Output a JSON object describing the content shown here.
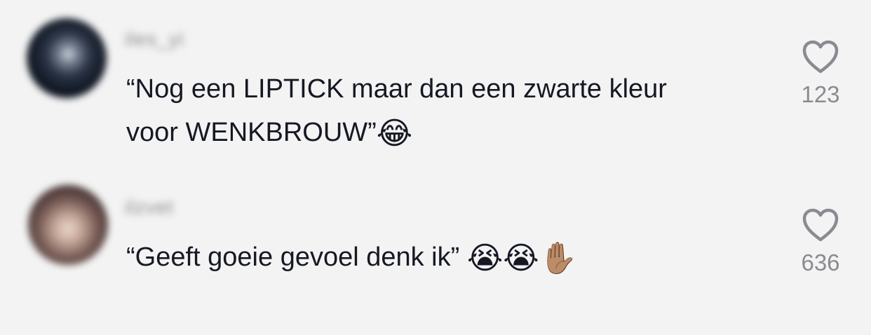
{
  "comments": [
    {
      "username": "iles_yi",
      "text": "“Nog een LIPTICK maar dan een zwarte kleur\nvoor WENKBROUW”",
      "emojis": "😂",
      "likes": "123"
    },
    {
      "username": "ilzvet",
      "text": "“Geeft goeie gevoel denk ik” ",
      "emojis": "😭😭✋🏽",
      "likes": "636"
    }
  ],
  "icons": {
    "like": "heart-outline-icon"
  },
  "colors": {
    "background": "#f3f3f3",
    "text": "#161823",
    "muted": "#8a8b91"
  }
}
